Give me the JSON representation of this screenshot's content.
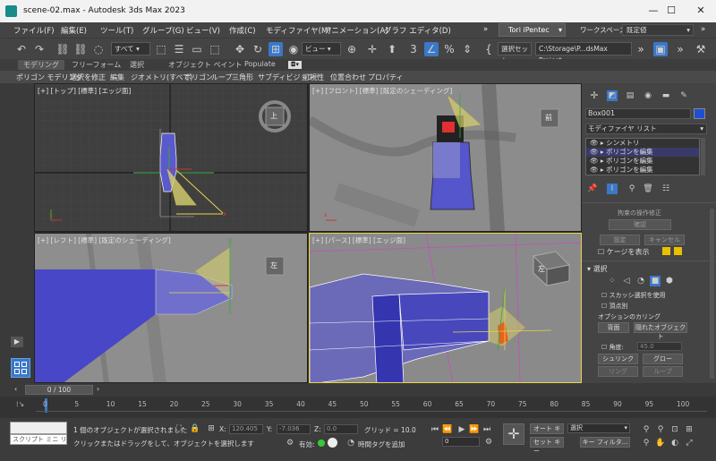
{
  "window": {
    "title": "scene-02.max - Autodesk 3ds Max 2023",
    "minimize": "—",
    "maximize": "☐",
    "close": "✕"
  },
  "menu": {
    "items": [
      "ファイル(F)",
      "編集(E)",
      "ツール(T)",
      "グループ(G)",
      "ビュー(V)",
      "作成(C)",
      "モディファイヤ(M)",
      "アニメーション(A)",
      "グラフ エディタ(D)",
      "»"
    ],
    "user": "Tori iPentec",
    "workspace_label": "ワークスペース:",
    "workspace_value": "既定値"
  },
  "toolbar": {
    "selection_filter": "すべて",
    "ref_coord": "ビュー",
    "named_selection": "選択セット",
    "project_path": "C:\\Storage\\P...dsMax Project"
  },
  "ribbon": {
    "tabs": [
      "モデリング",
      "フリーフォーム",
      "選択",
      "オブジェクト ペイント",
      "Populate"
    ],
    "subtabs": [
      "ポリゴン モデリング",
      "選択を修正",
      "編集",
      "ジオメトリ(すべて)",
      "ポリゴン",
      "ループ",
      "三角形",
      "サブディビジョン",
      "可視性",
      "位置合わせ",
      "プロパティ"
    ]
  },
  "viewports": {
    "top": {
      "label": "[+] [トップ] [標準] [エッジ面]",
      "cube_text": "上"
    },
    "front": {
      "label": "[+] [フロント] [標準] [既定のシェーディング]",
      "cube_text": "前"
    },
    "left": {
      "label": "[+] [レフト] [標準] [既定のシェーディング]",
      "cube_text": "左"
    },
    "persp": {
      "label": "[+] [パース] [標準] [エッジ面]",
      "cube_text": "左"
    }
  },
  "command_panel": {
    "object_name": "Box001",
    "modifier_list": "モディファイヤ リスト",
    "stack": [
      "シンメトリ",
      "ポリゴンを編集",
      "ポリゴンを編集",
      "ポリゴンを編集"
    ],
    "constraint_label": "拘束の操作修正",
    "confirm": "確認",
    "settings": "設定",
    "cancel": "キャンセル",
    "show_cage": "ケージを表示",
    "selection_title": "選択",
    "by_vertex": "スカッシ選択を使用",
    "ignore_backface": "頂点別",
    "culling_label": "オプションのカリング",
    "backface": "背面",
    "hidden_object": "隠れたオブジェクト",
    "angle_label": "角度:",
    "angle_value": "45.0",
    "shrink": "シュリンク",
    "grow": "グロー",
    "ring": "リング",
    "loop": "ループ"
  },
  "timeline": {
    "frame": "0 / 100",
    "ticks": [
      "0",
      "5",
      "10",
      "15",
      "20",
      "25",
      "30",
      "35",
      "40",
      "45",
      "50",
      "55",
      "60",
      "65",
      "70",
      "75",
      "80",
      "85",
      "90",
      "95",
      "100"
    ]
  },
  "status": {
    "script_label": "スクリプト ミニ リス",
    "selected": "1 個のオブジェクトが選択されました",
    "prompt": "クリックまたはドラッグをして、オブジェクトを選択します",
    "x_label": "X:",
    "x_value": "120.405",
    "y_label": "Y:",
    "y_value": "-7.036",
    "z_label": "Z:",
    "z_value": "0.0",
    "grid": "グリッド = 10.0",
    "enabled": "有効:",
    "add_time_tag": "時間タグを追加",
    "autokey": "オート キー",
    "setkey": "セット キー",
    "selected_drop": "選択",
    "key_filter": "キー フィルタ...",
    "frame_value": "0"
  },
  "colors": {
    "accent": "#3a78c8",
    "selection_yellow": "#e8d44a",
    "object_blue": "#5555cc"
  }
}
